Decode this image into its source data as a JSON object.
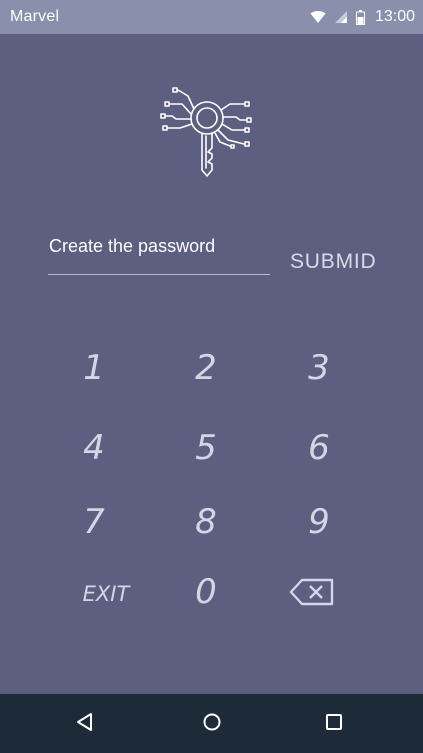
{
  "status_bar": {
    "carrier": "Marvel",
    "time": "13:00",
    "icons": [
      "wifi-icon",
      "signal-icon",
      "battery-icon"
    ]
  },
  "logo": {
    "icon": "key-circuit-icon"
  },
  "password": {
    "label": "Create the password",
    "submit_label": "SUBMID"
  },
  "keypad": {
    "keys": [
      "1",
      "2",
      "3",
      "4",
      "5",
      "6",
      "7",
      "8",
      "9",
      "EXIT",
      "0",
      "backspace"
    ],
    "exit_label": "EXIT",
    "backspace_icon": "backspace-icon"
  },
  "nav_bar": {
    "buttons": [
      "back-icon",
      "home-icon",
      "recents-icon"
    ]
  },
  "colors": {
    "background": "#5c5f80",
    "status_bar": "#8a90ab",
    "nav_bar": "#1d2a38",
    "text": "#ffffff",
    "key_text": "#d4d6e4"
  }
}
